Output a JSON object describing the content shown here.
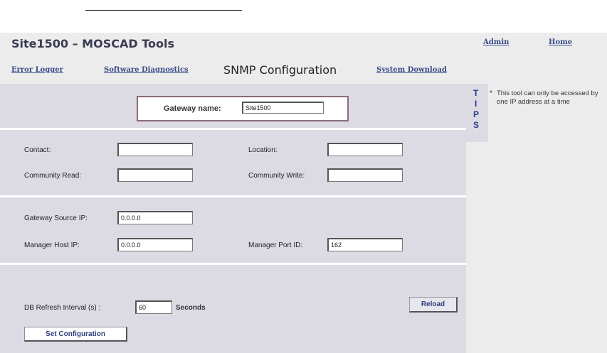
{
  "app": {
    "title": "Site1500 – MOSCAD Tools"
  },
  "header_links": {
    "admin": "Admin",
    "home": "Home"
  },
  "nav": {
    "error_logger": "Error Logger",
    "software_diagnostics": "Software Diagnostics",
    "current": "SNMP Configuration",
    "system_download": "System Download"
  },
  "gateway": {
    "label": "Gateway name:",
    "value": "Site1500"
  },
  "fields": {
    "contact": {
      "label": "Contact:",
      "value": ""
    },
    "location": {
      "label": "Location:",
      "value": ""
    },
    "community_read": {
      "label": "Community Read:",
      "value": ""
    },
    "community_write": {
      "label": "Community Write:",
      "value": ""
    },
    "gateway_source_ip": {
      "label": "Gateway Source IP:",
      "value": "0.0.0.0"
    },
    "manager_host_ip": {
      "label": "Manager Host IP:",
      "value": "0.0.0.0"
    },
    "manager_port_id": {
      "label": "Manager Port ID:",
      "value": "162"
    },
    "db_refresh": {
      "label": "DB Refresh Interval (s) :",
      "value": "60",
      "unit": "Seconds"
    }
  },
  "buttons": {
    "reload": "Reload",
    "set_configuration": "Set Configuration"
  },
  "tips": {
    "letters": [
      "T",
      "I",
      "P",
      "S"
    ],
    "bullet": "*",
    "text": "This tool can only be accessed by one IP address at a time"
  },
  "colors": {
    "band": "#dcdbe4",
    "link": "#3a4d8a",
    "tips_letters": "#2c3c86"
  }
}
